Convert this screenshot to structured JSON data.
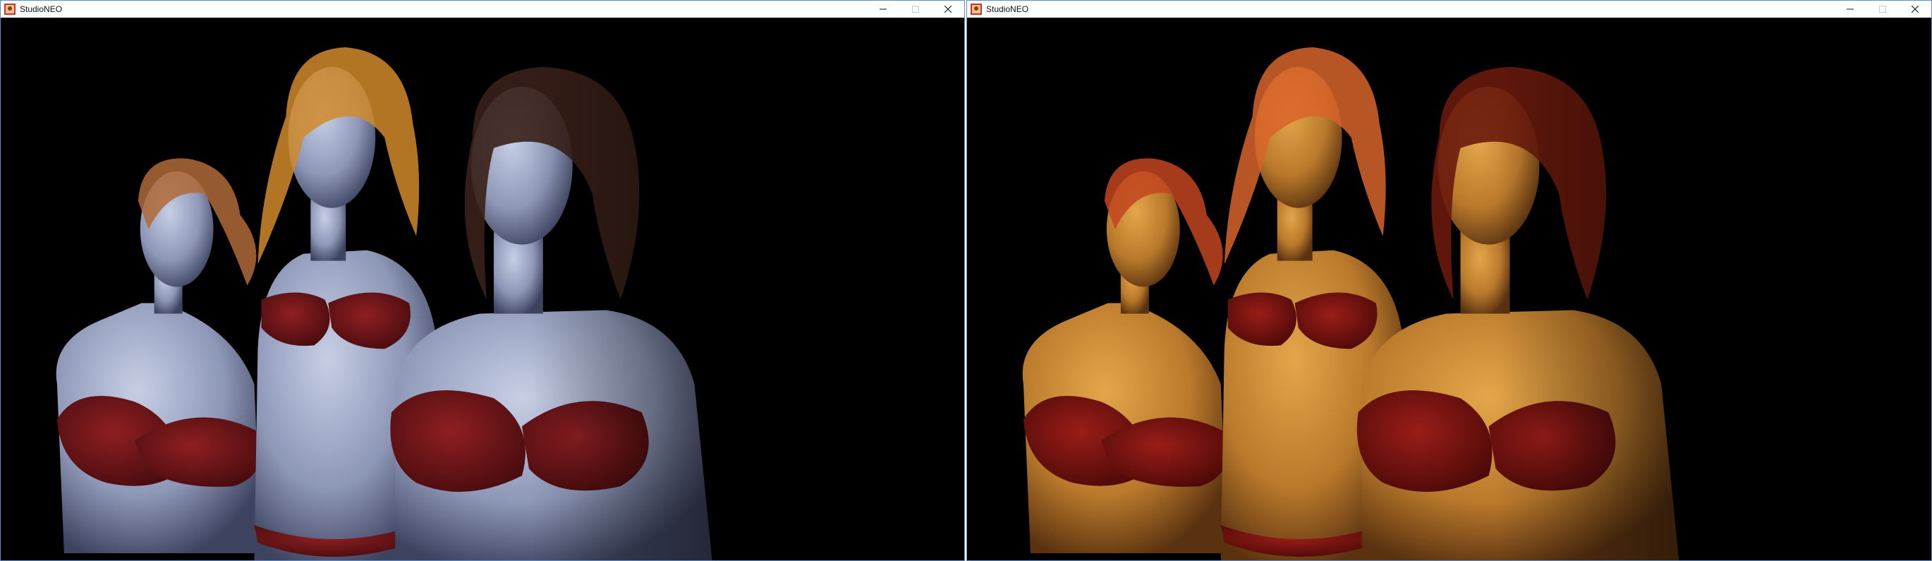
{
  "windows": [
    {
      "title": "StudioNEO",
      "lighting": "cool blue",
      "palette": {
        "skin_light": "#c7cfe6",
        "skin_mid": "#8d97b6",
        "skin_dark": "#3e4460",
        "hair_a": "#b06a38",
        "hair_b": "#d08a2a",
        "hair_c": "#3a2018",
        "bra": "#8e1f22",
        "bra_dark": "#4a0c0e",
        "bg": "#000000"
      }
    },
    {
      "title": "StudioNEO",
      "lighting": "warm amber",
      "palette": {
        "skin_light": "#e3a64a",
        "skin_mid": "#b9792b",
        "skin_dark": "#5a3210",
        "hair_a": "#c2451e",
        "hair_b": "#d8642a",
        "hair_c": "#6a1a0c",
        "bra": "#9a1d18",
        "bra_dark": "#4e0a08",
        "bg": "#000000"
      }
    }
  ],
  "icons": {
    "app": "studioneo-app-icon",
    "minimize": "minimize-icon",
    "maximize": "maximize-icon",
    "close": "close-icon"
  }
}
